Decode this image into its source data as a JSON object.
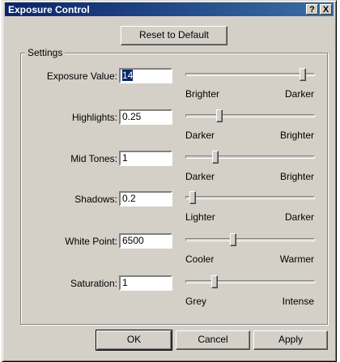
{
  "window": {
    "title": "Exposure Control",
    "help_label": "?",
    "close_label": "X"
  },
  "reset_label": "Reset to Default",
  "group_label": "Settings",
  "controls": [
    {
      "label": "Exposure Value:",
      "value": "14",
      "low": "Brighter",
      "high": "Darker",
      "level": 0.93,
      "selected": true
    },
    {
      "label": "Highlights:",
      "value": "0.25",
      "low": "Darker",
      "high": "Brighter",
      "level": 0.25,
      "selected": false
    },
    {
      "label": "Mid Tones:",
      "value": "1",
      "low": "Darker",
      "high": "Brighter",
      "level": 0.22,
      "selected": false
    },
    {
      "label": "Shadows:",
      "value": "0.2",
      "low": "Lighter",
      "high": "Darker",
      "level": 0.03,
      "selected": false
    },
    {
      "label": "White Point:",
      "value": "6500",
      "low": "Cooler",
      "high": "Warmer",
      "level": 0.36,
      "selected": false
    },
    {
      "label": "Saturation:",
      "value": "1",
      "low": "Grey",
      "high": "Intense",
      "level": 0.21,
      "selected": false
    }
  ],
  "buttons": {
    "ok_label": "OK",
    "cancel_label": "Cancel",
    "apply_label": "Apply"
  }
}
